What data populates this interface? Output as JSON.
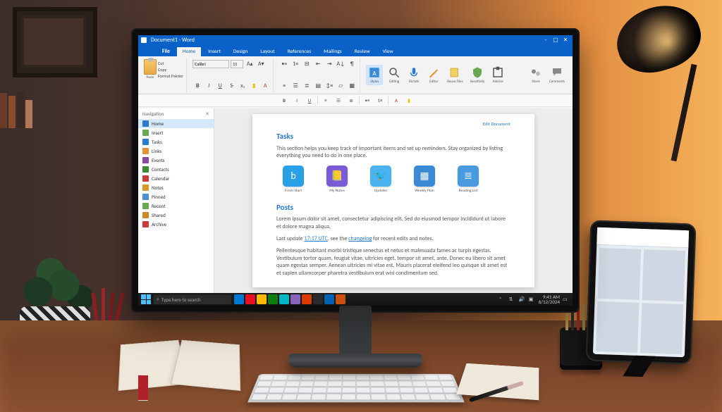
{
  "monitor": {
    "titlebar": {
      "doc_title": "Document1 - Word"
    },
    "tabs": {
      "file": "File",
      "items": [
        "Home",
        "Insert",
        "Design",
        "Layout",
        "References",
        "Mailings",
        "Review",
        "View"
      ],
      "active_index": 0
    },
    "ribbon": {
      "paste": "Paste",
      "clipboard_items": [
        "Cut",
        "Copy",
        "Format Painter"
      ],
      "font_name": "Calibri",
      "font_size": "11",
      "big_buttons": [
        {
          "label": "Styles"
        },
        {
          "label": "Editing"
        },
        {
          "label": "Dictate"
        },
        {
          "label": "Editor"
        },
        {
          "label": "Reuse Files"
        },
        {
          "label": "Sensitivity"
        },
        {
          "label": "Add-ins"
        }
      ],
      "right_buttons": [
        {
          "label": "Share"
        },
        {
          "label": "Comments"
        }
      ]
    },
    "navpane": {
      "header": "Navigation",
      "items": [
        {
          "label": "Home",
          "color": "#2a7ad1"
        },
        {
          "label": "Insert",
          "color": "#6aa84f"
        },
        {
          "label": "Tasks",
          "color": "#2a7ad1"
        },
        {
          "label": "Links",
          "color": "#e69138"
        },
        {
          "label": "Events",
          "color": "#8a4a9e"
        },
        {
          "label": "Contacts",
          "color": "#3a8a3a"
        },
        {
          "label": "Calendar",
          "color": "#cc3a3a"
        },
        {
          "label": "Notes",
          "color": "#d69a2a"
        },
        {
          "label": "Pinned",
          "color": "#4a90d6"
        },
        {
          "label": "Recent",
          "color": "#6aa84f"
        },
        {
          "label": "Shared",
          "color": "#cc8a2a"
        },
        {
          "label": "Archive",
          "color": "#cc3a3a"
        }
      ],
      "selected_index": 0
    },
    "document": {
      "top_link": "Edit Document",
      "h1": "Tasks",
      "p1": "This section helps you keep track of important items and set up reminders. Stay organized by listing everything you need to do in one place.",
      "apps": [
        {
          "label": "Fresh Start",
          "glyph": "b",
          "bg": "#2aa0e6"
        },
        {
          "label": "My Notes",
          "glyph": "📒",
          "bg": "#7a5ad6"
        },
        {
          "label": "Updates",
          "glyph": "🐦",
          "bg": "#4ab4f0"
        },
        {
          "label": "Weekly Plan",
          "glyph": "▦",
          "bg": "#3a8ad6"
        },
        {
          "label": "Reading List",
          "glyph": "≣",
          "bg": "#4a9ae0"
        }
      ],
      "h2": "Posts",
      "p2": "Lorem ipsum dolor sit amet, consectetur adipiscing elit. Sed do eiusmod tempor incididunt ut labore et dolore magna aliqua.",
      "p3a": "Last update ",
      "p3_link1": "17:17 UTC",
      "p3b": ", see the ",
      "p3_link2": "changelog",
      "p3c": " for recent edits and notes.",
      "p4": "Pellentesque habitant morbi tristique senectus et netus et malesuada fames ac turpis egestas. Vestibulum tortor quam, feugiat vitae, ultricies eget, tempor sit amet, ante. Donec eu libero sit amet quam egestas semper. Aenean ultricies mi vitae est. Mauris placerat eleifend leo quisque sit amet est et sapien ullamcorper pharetra vestibulum erat wisi condimentum sed."
    },
    "taskbar": {
      "search_placeholder": "Type here to search",
      "time": "9:41 AM",
      "date": "6/12/2024",
      "pinned_colors": [
        "#0078d4",
        "#e81123",
        "#ffb900",
        "#107c10",
        "#00b7c3",
        "#8764b8",
        "#d83b01",
        "#2a2a2a",
        "#0063b1",
        "#ca5010"
      ]
    }
  }
}
